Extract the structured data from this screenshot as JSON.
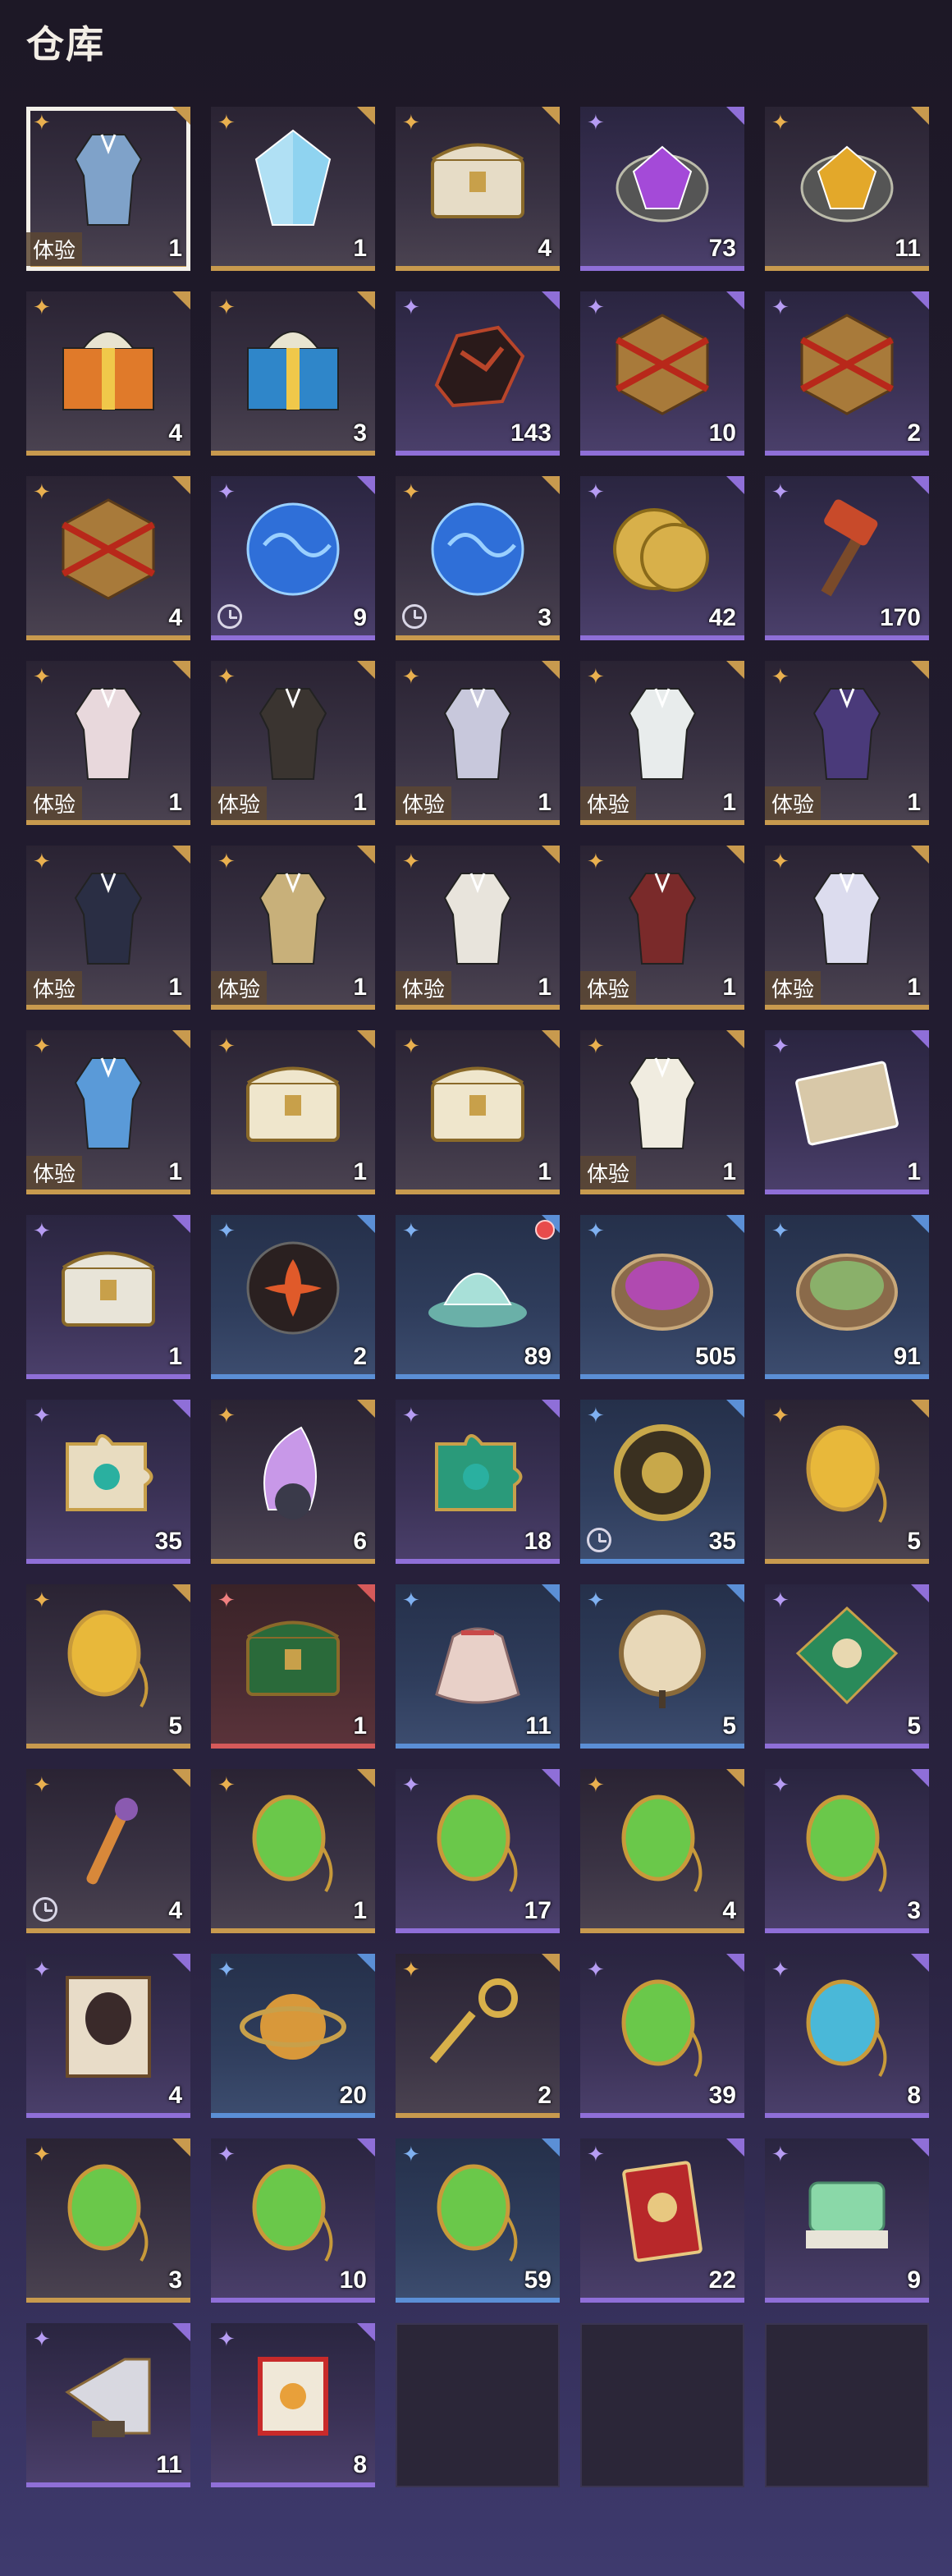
{
  "title": "仓库",
  "slots": [
    {
      "count": "1",
      "rarity": "gold",
      "icon": "costume-icon",
      "trial": "体验",
      "selected": true,
      "color": "#7fa2c9"
    },
    {
      "count": "1",
      "rarity": "gold",
      "icon": "crystal-icon",
      "color": "#8fd3f0"
    },
    {
      "count": "4",
      "rarity": "gold",
      "icon": "chest-icon",
      "color": "#e6dcc6"
    },
    {
      "count": "73",
      "rarity": "purple",
      "icon": "gem-icon",
      "color": "#a44ad8"
    },
    {
      "count": "11",
      "rarity": "gold",
      "icon": "gem-icon",
      "color": "#e3a82a"
    },
    {
      "count": "4",
      "rarity": "gold",
      "icon": "gift-box-icon",
      "color": "#e07a2a"
    },
    {
      "count": "3",
      "rarity": "gold",
      "icon": "gift-box-icon",
      "color": "#2f86c9"
    },
    {
      "count": "143",
      "rarity": "purple",
      "icon": "ore-icon",
      "color": "#b8452a"
    },
    {
      "count": "10",
      "rarity": "purple",
      "icon": "dice-box-icon",
      "color": "#a87a3a"
    },
    {
      "count": "2",
      "rarity": "purple",
      "icon": "dice-box-icon",
      "color": "#a87a3a"
    },
    {
      "count": "4",
      "rarity": "gold",
      "icon": "dice-box-icon",
      "color": "#a87a3a"
    },
    {
      "count": "9",
      "rarity": "purple",
      "icon": "orb-icon",
      "clock": true,
      "color": "#2f6fd8"
    },
    {
      "count": "3",
      "rarity": "gold",
      "icon": "orb-icon",
      "clock": true,
      "color": "#2f6fd8"
    },
    {
      "count": "42",
      "rarity": "purple",
      "icon": "coin-icon",
      "color": "#d8b04a"
    },
    {
      "count": "170",
      "rarity": "purple",
      "icon": "hammer-icon",
      "color": "#c84a2a"
    },
    {
      "count": "1",
      "rarity": "gold",
      "icon": "costume-icon",
      "trial": "体验",
      "color": "#e8d8dc"
    },
    {
      "count": "1",
      "rarity": "gold",
      "icon": "costume-icon",
      "trial": "体验",
      "color": "#3a3430"
    },
    {
      "count": "1",
      "rarity": "gold",
      "icon": "costume-icon",
      "trial": "体验",
      "color": "#c8c8dc"
    },
    {
      "count": "1",
      "rarity": "gold",
      "icon": "costume-icon",
      "trial": "体验",
      "color": "#e8ecec"
    },
    {
      "count": "1",
      "rarity": "gold",
      "icon": "costume-icon",
      "trial": "体验",
      "color": "#4a3a7a"
    },
    {
      "count": "1",
      "rarity": "gold",
      "icon": "costume-icon",
      "trial": "体验",
      "color": "#2a2e44"
    },
    {
      "count": "1",
      "rarity": "gold",
      "icon": "costume-icon",
      "trial": "体验",
      "color": "#c8b07a"
    },
    {
      "count": "1",
      "rarity": "gold",
      "icon": "costume-icon",
      "trial": "体验",
      "color": "#e8e4dc"
    },
    {
      "count": "1",
      "rarity": "gold",
      "icon": "costume-icon",
      "trial": "体验",
      "color": "#7a2a2a"
    },
    {
      "count": "1",
      "rarity": "gold",
      "icon": "costume-icon",
      "trial": "体验",
      "color": "#dcdcee"
    },
    {
      "count": "1",
      "rarity": "gold",
      "icon": "costume-icon",
      "trial": "体验",
      "color": "#5a9ad8"
    },
    {
      "count": "1",
      "rarity": "gold",
      "icon": "chest-icon",
      "color": "#efe6cc"
    },
    {
      "count": "1",
      "rarity": "gold",
      "icon": "chest-icon",
      "color": "#efe6cc"
    },
    {
      "count": "1",
      "rarity": "gold",
      "icon": "costume-icon",
      "trial": "体验",
      "color": "#f0ece0"
    },
    {
      "count": "1",
      "rarity": "purple",
      "icon": "card-icon",
      "color": "#d8c8a8"
    },
    {
      "count": "1",
      "rarity": "purple",
      "icon": "chest-icon",
      "color": "#e8e4d8"
    },
    {
      "count": "2",
      "rarity": "blue",
      "icon": "flower-emblem-icon",
      "color": "#e05a2a"
    },
    {
      "count": "89",
      "rarity": "blue",
      "icon": "lotus-icon",
      "redmark": true,
      "color": "#a8e0d8"
    },
    {
      "count": "505",
      "rarity": "blue",
      "icon": "powder-bowl-icon",
      "color": "#b04ab0"
    },
    {
      "count": "91",
      "rarity": "blue",
      "icon": "powder-bowl-icon",
      "color": "#8ab06a"
    },
    {
      "count": "35",
      "rarity": "purple",
      "icon": "puzzle-icon",
      "color": "#e8dcc0"
    },
    {
      "count": "6",
      "rarity": "gold",
      "icon": "feather-orb-icon",
      "color": "#c898e8"
    },
    {
      "count": "18",
      "rarity": "purple",
      "icon": "puzzle-icon",
      "color": "#2a9a7a"
    },
    {
      "count": "35",
      "rarity": "blue",
      "icon": "medallion-icon",
      "clock": true,
      "color": "#c8a84a"
    },
    {
      "count": "5",
      "rarity": "gold",
      "icon": "pendant-icon",
      "color": "#e8b83a"
    },
    {
      "count": "5",
      "rarity": "gold",
      "icon": "pendant-icon",
      "color": "#e8b83a"
    },
    {
      "count": "1",
      "rarity": "red",
      "icon": "chest-icon",
      "color": "#2a6a3a"
    },
    {
      "count": "11",
      "rarity": "blue",
      "icon": "pouch-icon",
      "color": "#e8d0c8"
    },
    {
      "count": "5",
      "rarity": "blue",
      "icon": "drum-icon",
      "color": "#e8d8b8"
    },
    {
      "count": "5",
      "rarity": "purple",
      "icon": "kite-icon",
      "color": "#2a8a5a"
    },
    {
      "count": "4",
      "rarity": "gold",
      "icon": "key-wand-icon",
      "clock": true,
      "color": "#d8883a"
    },
    {
      "count": "1",
      "rarity": "gold",
      "icon": "pendant-icon",
      "color": "#6ac84a"
    },
    {
      "count": "17",
      "rarity": "purple",
      "icon": "pendant-icon",
      "color": "#6ac84a"
    },
    {
      "count": "4",
      "rarity": "gold",
      "icon": "pendant-icon",
      "color": "#6ac84a"
    },
    {
      "count": "3",
      "rarity": "purple",
      "icon": "pendant-icon",
      "color": "#6ac84a"
    },
    {
      "count": "4",
      "rarity": "purple",
      "icon": "portrait-scroll-icon",
      "color": "#e8dcc8"
    },
    {
      "count": "20",
      "rarity": "blue",
      "icon": "astrolabe-icon",
      "color": "#d8983a"
    },
    {
      "count": "2",
      "rarity": "gold",
      "icon": "key-icon",
      "color": "#d8b04a"
    },
    {
      "count": "39",
      "rarity": "purple",
      "icon": "pendant-icon",
      "color": "#6ac84a"
    },
    {
      "count": "8",
      "rarity": "purple",
      "icon": "pendant-icon",
      "color": "#4ab8d8"
    },
    {
      "count": "3",
      "rarity": "gold",
      "icon": "pendant-icon",
      "color": "#6ac84a"
    },
    {
      "count": "10",
      "rarity": "purple",
      "icon": "pendant-icon",
      "color": "#6ac84a"
    },
    {
      "count": "59",
      "rarity": "blue",
      "icon": "pendant-icon",
      "color": "#6ac84a"
    },
    {
      "count": "22",
      "rarity": "purple",
      "icon": "red-card-icon",
      "color": "#b8282a"
    },
    {
      "count": "9",
      "rarity": "purple",
      "icon": "jade-seal-icon",
      "color": "#8ad8a8"
    },
    {
      "count": "11",
      "rarity": "purple",
      "icon": "horn-icon",
      "color": "#d8d8e0"
    },
    {
      "count": "8",
      "rarity": "purple",
      "icon": "scroll-icon",
      "color": "#c82a2a"
    },
    {
      "empty": true
    },
    {
      "empty": true
    },
    {
      "empty": true
    }
  ]
}
